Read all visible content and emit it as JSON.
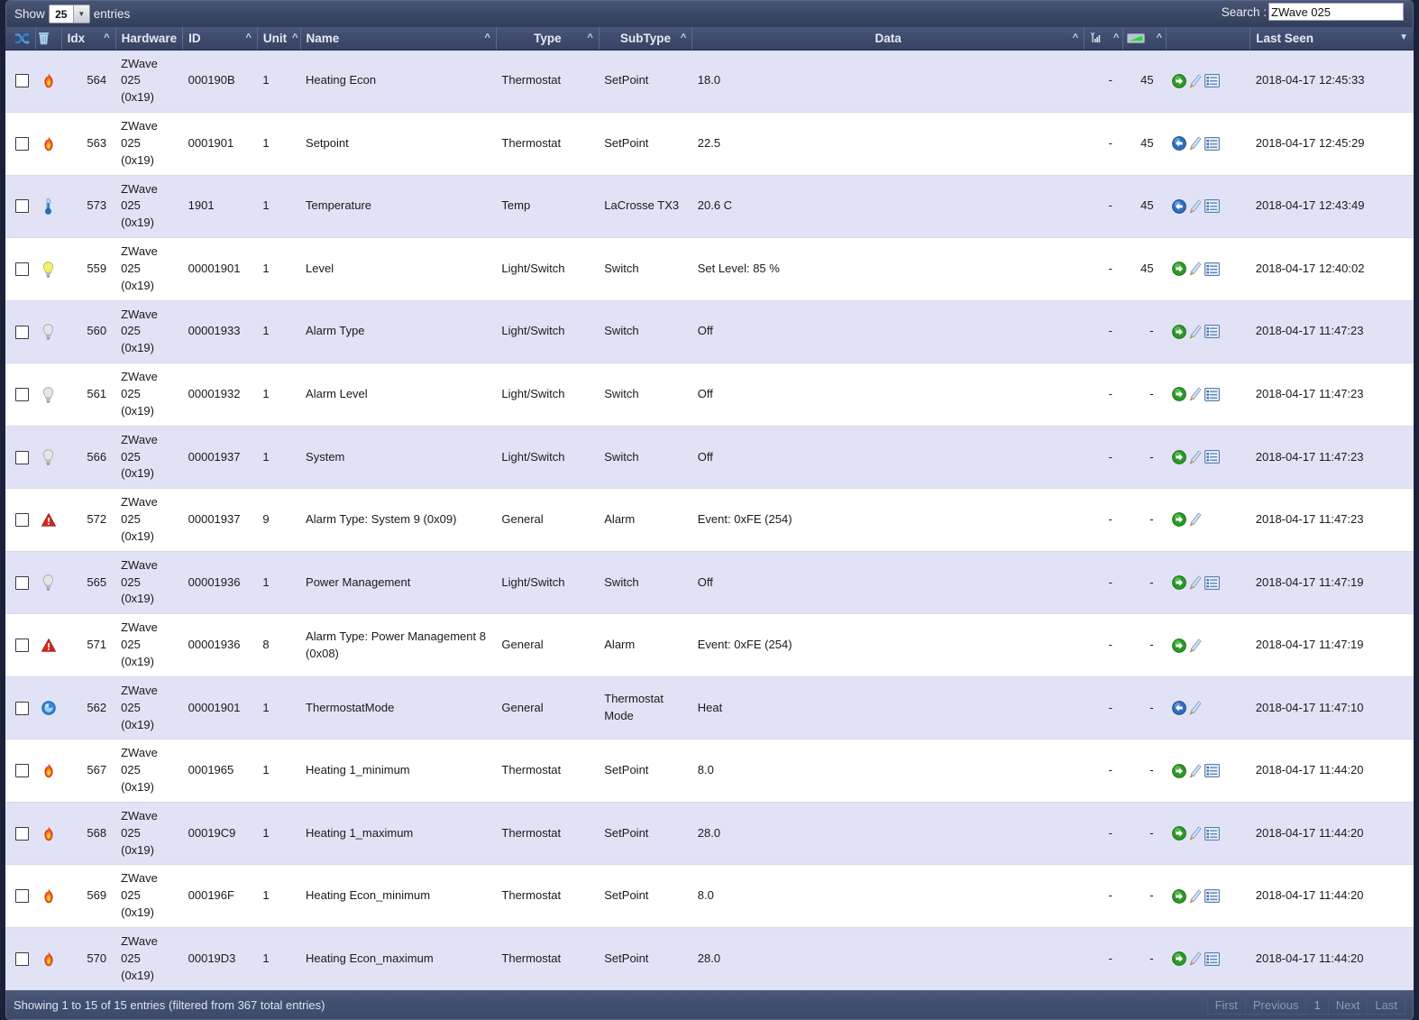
{
  "toolbar": {
    "show_label": "Show",
    "page_length": "25",
    "entries_label": "entries",
    "search_label": "Search :",
    "search_value": "ZWave 025",
    "search_placeholder": ""
  },
  "table": {
    "columns": [
      {
        "key": "check",
        "label": "",
        "sort": "",
        "icon": "checkbox-all"
      },
      {
        "key": "icon",
        "label": "",
        "sort": "",
        "icon": "shuffle-icon"
      },
      {
        "key": "trash",
        "label": "",
        "sort": "",
        "icon": "trash-icon"
      },
      {
        "key": "idx",
        "label": "Idx",
        "sort": "asc"
      },
      {
        "key": "hw",
        "label": "Hardware",
        "sort": "asc"
      },
      {
        "key": "id",
        "label": "ID",
        "sort": "asc"
      },
      {
        "key": "unit",
        "label": "Unit",
        "sort": "asc"
      },
      {
        "key": "name",
        "label": "Name",
        "sort": "asc"
      },
      {
        "key": "type",
        "label": "Type",
        "sort": "asc"
      },
      {
        "key": "sub",
        "label": "SubType",
        "sort": "asc"
      },
      {
        "key": "data",
        "label": "Data",
        "sort": "asc"
      },
      {
        "key": "signal",
        "label": "",
        "sort": "asc",
        "icon": "signal-icon"
      },
      {
        "key": "batt",
        "label": "",
        "sort": "asc",
        "icon": "battery-icon"
      },
      {
        "key": "act",
        "label": "",
        "sort": ""
      },
      {
        "key": "seen",
        "label": "Last Seen",
        "sort": "desc"
      }
    ],
    "header_labels": {
      "idx": "Idx",
      "hardware": "Hardware",
      "id": "ID",
      "unit": "Unit",
      "name": "Name",
      "type": "Type",
      "subtype": "SubType",
      "data": "Data",
      "last_seen": "Last Seen"
    },
    "rows": [
      {
        "icon": "flame-icon",
        "idx": "564",
        "hardware": "ZWave 025",
        "hardware2": "(0x19)",
        "id": "000190B",
        "unit": "1",
        "name": "Heating Econ",
        "type": "Thermostat",
        "subtype": "SetPoint",
        "subtype2": "",
        "data": "18.0",
        "signal": "-",
        "battery": "45",
        "actions": [
          "arrow-right-green",
          "pencil-icon",
          "log-icon"
        ],
        "last_seen": "2018-04-17 12:45:33"
      },
      {
        "icon": "flame-icon",
        "idx": "563",
        "hardware": "ZWave 025",
        "hardware2": "(0x19)",
        "id": "0001901",
        "unit": "1",
        "name": "Setpoint",
        "type": "Thermostat",
        "subtype": "SetPoint",
        "subtype2": "",
        "data": "22.5",
        "signal": "-",
        "battery": "45",
        "actions": [
          "arrow-left-blue",
          "pencil-icon",
          "log-icon"
        ],
        "last_seen": "2018-04-17 12:45:29"
      },
      {
        "icon": "thermometer-icon",
        "idx": "573",
        "hardware": "ZWave 025",
        "hardware2": "(0x19)",
        "id": "1901",
        "unit": "1",
        "name": "Temperature",
        "type": "Temp",
        "subtype": "LaCrosse TX3",
        "subtype2": "",
        "data": "20.6 C",
        "signal": "-",
        "battery": "45",
        "actions": [
          "arrow-left-blue",
          "pencil-icon",
          "log-icon"
        ],
        "last_seen": "2018-04-17 12:43:49"
      },
      {
        "icon": "bulb-on-icon",
        "idx": "559",
        "hardware": "ZWave 025",
        "hardware2": "(0x19)",
        "id": "00001901",
        "unit": "1",
        "name": "Level",
        "type": "Light/Switch",
        "subtype": "Switch",
        "subtype2": "",
        "data": "Set Level: 85 %",
        "signal": "-",
        "battery": "45",
        "actions": [
          "arrow-right-green",
          "pencil-icon",
          "log-icon"
        ],
        "last_seen": "2018-04-17 12:40:02"
      },
      {
        "icon": "bulb-off-icon",
        "idx": "560",
        "hardware": "ZWave 025",
        "hardware2": "(0x19)",
        "id": "00001933",
        "unit": "1",
        "name": "Alarm Type",
        "type": "Light/Switch",
        "subtype": "Switch",
        "subtype2": "",
        "data": "Off",
        "signal": "-",
        "battery": "-",
        "actions": [
          "arrow-right-green",
          "pencil-icon",
          "log-icon"
        ],
        "last_seen": "2018-04-17 11:47:23"
      },
      {
        "icon": "bulb-off-icon",
        "idx": "561",
        "hardware": "ZWave 025",
        "hardware2": "(0x19)",
        "id": "00001932",
        "unit": "1",
        "name": "Alarm Level",
        "type": "Light/Switch",
        "subtype": "Switch",
        "subtype2": "",
        "data": "Off",
        "signal": "-",
        "battery": "-",
        "actions": [
          "arrow-right-green",
          "pencil-icon",
          "log-icon"
        ],
        "last_seen": "2018-04-17 11:47:23"
      },
      {
        "icon": "bulb-off-icon",
        "idx": "566",
        "hardware": "ZWave 025",
        "hardware2": "(0x19)",
        "id": "00001937",
        "unit": "1",
        "name": "System",
        "type": "Light/Switch",
        "subtype": "Switch",
        "subtype2": "",
        "data": "Off",
        "signal": "-",
        "battery": "-",
        "actions": [
          "arrow-right-green",
          "pencil-icon",
          "log-icon"
        ],
        "last_seen": "2018-04-17 11:47:23"
      },
      {
        "icon": "alarm-icon",
        "idx": "572",
        "hardware": "ZWave 025",
        "hardware2": "(0x19)",
        "id": "00001937",
        "unit": "9",
        "name": "Alarm Type: System 9 (0x09)",
        "type": "General",
        "subtype": "Alarm",
        "subtype2": "",
        "data": "Event: 0xFE (254)",
        "signal": "-",
        "battery": "-",
        "actions": [
          "arrow-right-green",
          "pencil-icon"
        ],
        "last_seen": "2018-04-17 11:47:23"
      },
      {
        "icon": "bulb-off-icon",
        "idx": "565",
        "hardware": "ZWave 025",
        "hardware2": "(0x19)",
        "id": "00001936",
        "unit": "1",
        "name": "Power Management",
        "type": "Light/Switch",
        "subtype": "Switch",
        "subtype2": "",
        "data": "Off",
        "signal": "-",
        "battery": "-",
        "actions": [
          "arrow-right-green",
          "pencil-icon",
          "log-icon"
        ],
        "last_seen": "2018-04-17 11:47:19"
      },
      {
        "icon": "alarm-icon",
        "idx": "571",
        "hardware": "ZWave 025",
        "hardware2": "(0x19)",
        "id": "00001936",
        "unit": "8",
        "name": "Alarm Type: Power Management 8 (0x08)",
        "type": "General",
        "subtype": "Alarm",
        "subtype2": "",
        "data": "Event: 0xFE (254)",
        "signal": "-",
        "battery": "-",
        "actions": [
          "arrow-right-green",
          "pencil-icon"
        ],
        "last_seen": "2018-04-17 11:47:19"
      },
      {
        "icon": "mode-icon",
        "idx": "562",
        "hardware": "ZWave 025",
        "hardware2": "(0x19)",
        "id": "00001901",
        "unit": "1",
        "name": "ThermostatMode",
        "type": "General",
        "subtype": "Thermostat",
        "subtype2": "Mode",
        "data": "Heat",
        "signal": "-",
        "battery": "-",
        "actions": [
          "arrow-left-blue",
          "pencil-icon"
        ],
        "last_seen": "2018-04-17 11:47:10"
      },
      {
        "icon": "flame-icon",
        "idx": "567",
        "hardware": "ZWave 025",
        "hardware2": "(0x19)",
        "id": "0001965",
        "unit": "1",
        "name": "Heating 1_minimum",
        "type": "Thermostat",
        "subtype": "SetPoint",
        "subtype2": "",
        "data": "8.0",
        "signal": "-",
        "battery": "-",
        "actions": [
          "arrow-right-green",
          "pencil-icon",
          "log-icon"
        ],
        "last_seen": "2018-04-17 11:44:20"
      },
      {
        "icon": "flame-icon",
        "idx": "568",
        "hardware": "ZWave 025",
        "hardware2": "(0x19)",
        "id": "00019C9",
        "unit": "1",
        "name": "Heating 1_maximum",
        "type": "Thermostat",
        "subtype": "SetPoint",
        "subtype2": "",
        "data": "28.0",
        "signal": "-",
        "battery": "-",
        "actions": [
          "arrow-right-green",
          "pencil-icon",
          "log-icon"
        ],
        "last_seen": "2018-04-17 11:44:20"
      },
      {
        "icon": "flame-icon",
        "idx": "569",
        "hardware": "ZWave 025",
        "hardware2": "(0x19)",
        "id": "000196F",
        "unit": "1",
        "name": "Heating Econ_minimum",
        "type": "Thermostat",
        "subtype": "SetPoint",
        "subtype2": "",
        "data": "8.0",
        "signal": "-",
        "battery": "-",
        "actions": [
          "arrow-right-green",
          "pencil-icon",
          "log-icon"
        ],
        "last_seen": "2018-04-17 11:44:20"
      },
      {
        "icon": "flame-icon",
        "idx": "570",
        "hardware": "ZWave 025",
        "hardware2": "(0x19)",
        "id": "00019D3",
        "unit": "1",
        "name": "Heating Econ_maximum",
        "type": "Thermostat",
        "subtype": "SetPoint",
        "subtype2": "",
        "data": "28.0",
        "signal": "-",
        "battery": "-",
        "actions": [
          "arrow-right-green",
          "pencil-icon",
          "log-icon"
        ],
        "last_seen": "2018-04-17 11:44:20"
      }
    ]
  },
  "footer": {
    "info": "Showing 1 to 15 of 15 entries (filtered from 367 total entries)",
    "pagination": [
      "First",
      "Previous",
      "1",
      "Next",
      "Last"
    ],
    "current_page": "1"
  },
  "colors": {
    "header_bg": "#414d6e",
    "row_odd": "#e2e2f7",
    "row_even": "#ffffff",
    "page_bg": "#1b2138",
    "accent_green": "#35a035",
    "accent_blue": "#2a6fc4"
  }
}
